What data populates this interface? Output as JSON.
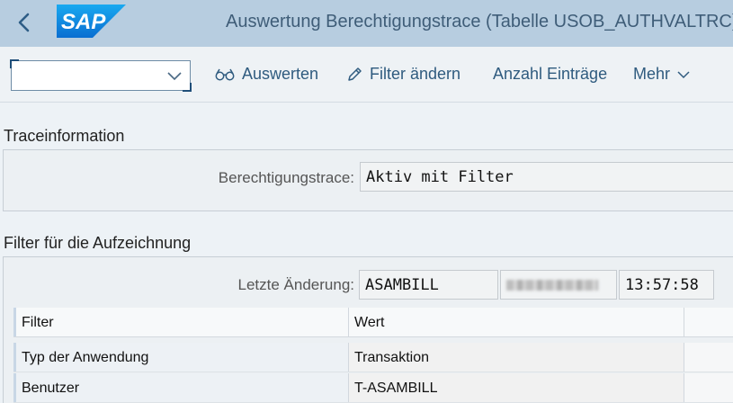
{
  "header": {
    "title": "Auswertung Berechtigungstrace (Tabelle USOB_AUTHVALTRC)",
    "logo_text": "SAP"
  },
  "toolbar": {
    "variant_select_value": "",
    "evaluate_label": "Auswerten",
    "change_filter_label": "Filter ändern",
    "count_entries_label": "Anzahl Einträge",
    "more_label": "Mehr"
  },
  "trace_info": {
    "title": "Traceinformation",
    "auth_trace_label": "Berechtigungstrace:",
    "auth_trace_value": "Aktiv mit Filter"
  },
  "filter_section": {
    "title": "Filter für die Aufzeichnung",
    "last_change_label": "Letzte Änderung:",
    "last_change_user": "ASAMBILL",
    "last_change_time": "13:57:58"
  },
  "table": {
    "columns": [
      "Filter",
      "Wert"
    ],
    "rows": [
      [
        "Typ der Anwendung",
        "Transaktion"
      ],
      [
        "Benutzer",
        "T-ASAMBILL"
      ]
    ]
  },
  "colors": {
    "header_bg": "#b7cde0",
    "sap_blue": "#0a6ed1",
    "link_blue": "#2f5b7f"
  }
}
